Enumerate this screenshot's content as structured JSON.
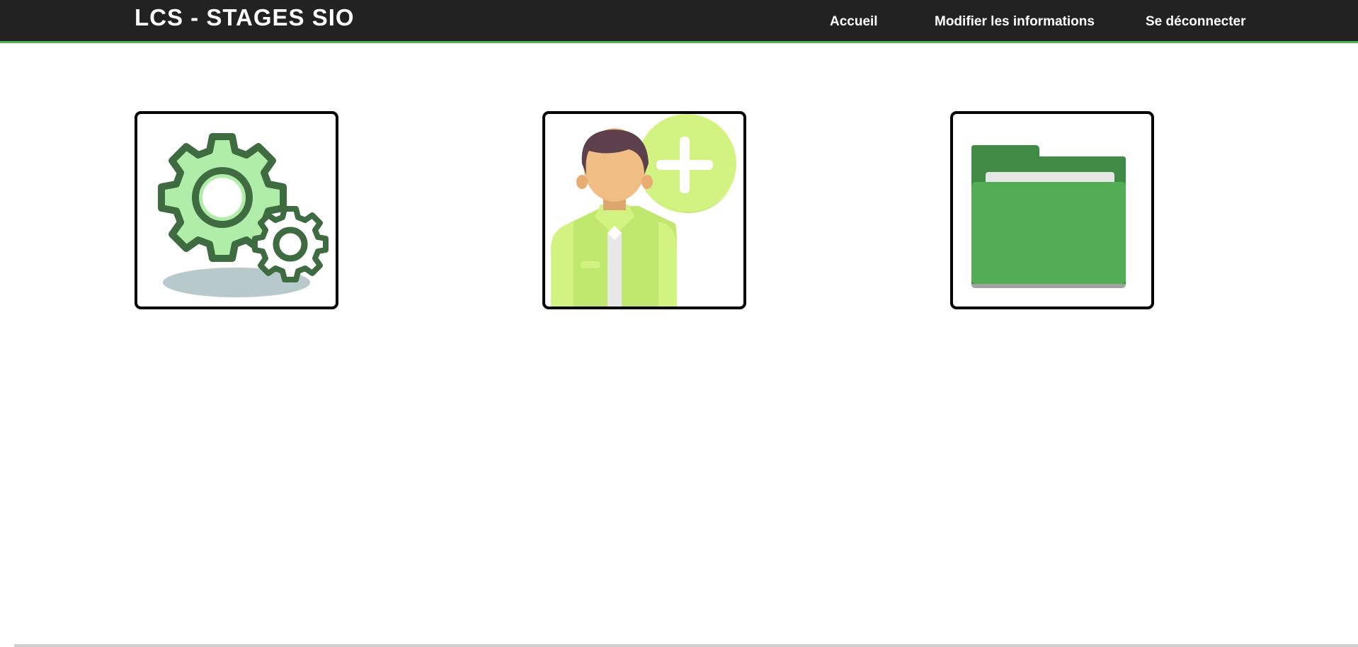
{
  "app": {
    "title": "LCS - STAGES SIO"
  },
  "nav": {
    "items": [
      {
        "label": "Accueil"
      },
      {
        "label": "Modifier les informations"
      },
      {
        "label": "Se déconnecter"
      }
    ]
  },
  "tiles": [
    {
      "icon": "gears-icon"
    },
    {
      "icon": "add-user-icon"
    },
    {
      "icon": "folder-icon"
    }
  ],
  "colors": {
    "header_bg": "#222222",
    "header_accent": "#4fb35a",
    "gear_dark": "#3f6b40",
    "gear_light": "#b0eda8",
    "folder_green": "#52ad55",
    "lime": "#d2f382"
  }
}
